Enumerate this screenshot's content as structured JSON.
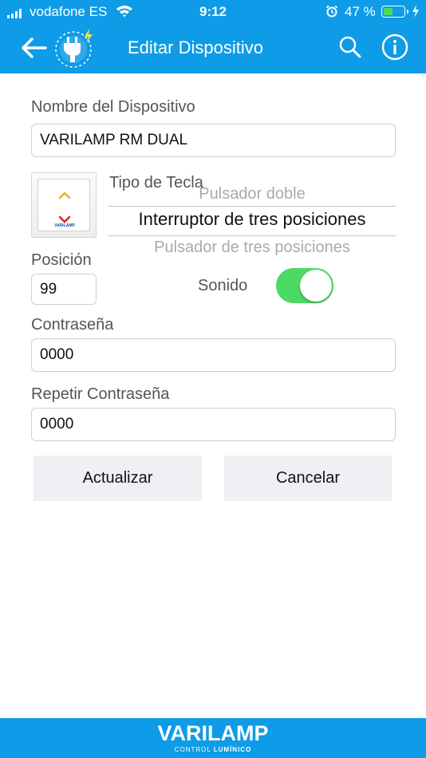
{
  "status_bar": {
    "carrier": "vodafone ES",
    "time": "9:12",
    "battery_percent": "47 %",
    "battery_level": 0.47
  },
  "nav": {
    "title": "Editar Dispositivo",
    "back_icon": "arrow-left-icon",
    "logo_icon": "plug-icon",
    "search_icon": "search-icon",
    "info_icon": "info-icon"
  },
  "form": {
    "device_name_label": "Nombre del Dispositivo",
    "device_name_value": "VARILAMP RM DUAL",
    "key_type_label": "Tipo de Tecla",
    "keypad_brand": "VARILAMP",
    "key_type_options": [
      "Pulsador doble",
      "Interruptor de tres posiciones",
      "Pulsador de tres posiciones"
    ],
    "key_type_selected": "Interruptor de tres posiciones",
    "position_label": "Posición",
    "position_value": "99",
    "sound_label": "Sonido",
    "sound_enabled": true,
    "password_label": "Contraseña",
    "password_value": "0000",
    "repeat_password_label": "Repetir Contraseña",
    "repeat_password_value": "0000"
  },
  "actions": {
    "update_label": "Actualizar",
    "cancel_label": "Cancelar"
  },
  "footer": {
    "brand": "VARILAMP",
    "tagline_part1": "CONTROL",
    "tagline_part2": "LUMÍNICO"
  },
  "colors": {
    "primary": "#0e9be7",
    "toggle_on": "#4cd964",
    "button_bg": "#efeff4"
  }
}
